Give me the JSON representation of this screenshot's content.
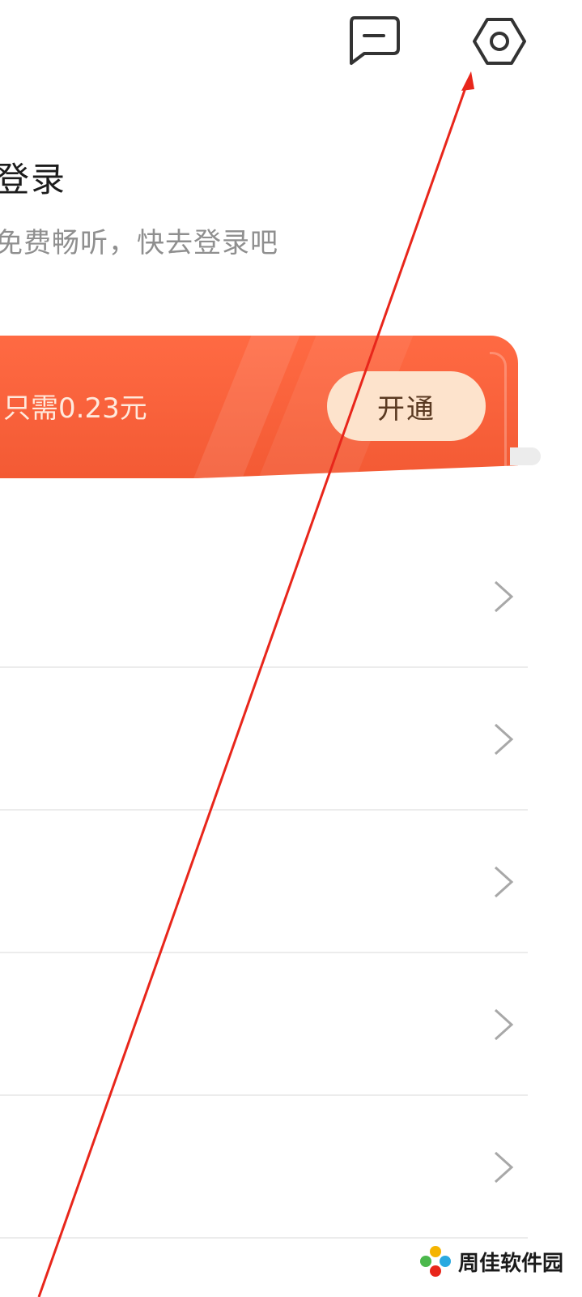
{
  "header": {
    "message_icon": "message-square-icon",
    "settings_icon": "gear-hexagon-icon"
  },
  "login": {
    "title": "登录",
    "subtitle": "免费畅听，快去登录吧"
  },
  "vip_banner": {
    "text": "只需0.23元",
    "button_label": "开通",
    "accent_color": "#f35a34",
    "button_color": "#fde3cc"
  },
  "menu": {
    "rows": [
      {
        "chevron": "chevron-right-icon"
      },
      {
        "chevron": "chevron-right-icon"
      },
      {
        "chevron": "chevron-right-icon"
      },
      {
        "chevron": "chevron-right-icon"
      },
      {
        "chevron": "chevron-right-icon"
      }
    ]
  },
  "annotation": {
    "arrow_color": "#e8261b"
  },
  "watermark": {
    "text": "周佳软件园"
  }
}
